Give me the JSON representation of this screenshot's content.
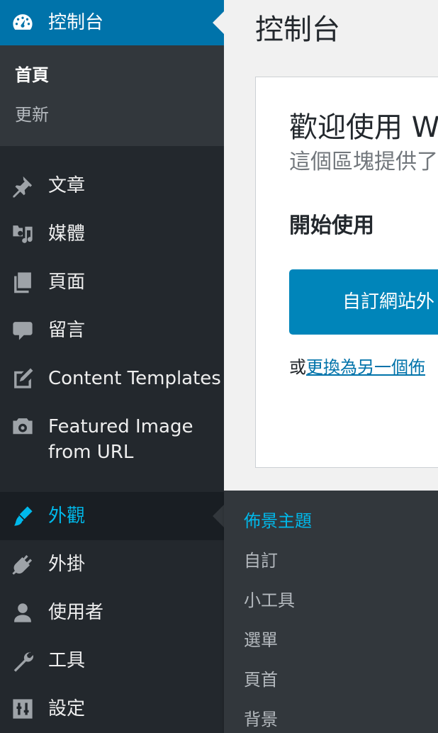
{
  "sidebar": {
    "dashboard": {
      "label": "控制台",
      "icon": "dashboard-icon"
    },
    "dashboard_submenu": {
      "home": "首頁",
      "updates": "更新"
    },
    "items": [
      {
        "label": "文章",
        "icon": "pin-icon"
      },
      {
        "label": "媒體",
        "icon": "media-icon"
      },
      {
        "label": "頁面",
        "icon": "pages-icon"
      },
      {
        "label": "留言",
        "icon": "comment-icon"
      },
      {
        "label": "Content Templates",
        "icon": "edit-page-icon"
      },
      {
        "label_line1": "Featured Image",
        "label_line2": "from URL",
        "icon": "camera-icon"
      },
      {
        "label": "外觀",
        "icon": "paintbrush-icon"
      },
      {
        "label": "外掛",
        "icon": "plugin-icon"
      },
      {
        "label": "使用者",
        "icon": "user-icon"
      },
      {
        "label": "工具",
        "icon": "wrench-icon"
      },
      {
        "label": "設定",
        "icon": "settings-sliders-icon"
      }
    ],
    "appearance_submenu": [
      "佈景主題",
      "自訂",
      "小工具",
      "選單",
      "頁首",
      "背景"
    ]
  },
  "main": {
    "page_title": "控制台",
    "welcome": {
      "title": "歡迎使用 W",
      "description": "這個區塊提供了",
      "get_started": "開始使用",
      "customize_button": "自訂網站外",
      "or_text": "或",
      "change_theme_link": "更換為另一個佈"
    }
  },
  "colors": {
    "sidebar_bg": "#23282d",
    "submenu_bg": "#32373c",
    "accent": "#0073aa",
    "current_text": "#00b9eb",
    "button": "#0085ba"
  }
}
